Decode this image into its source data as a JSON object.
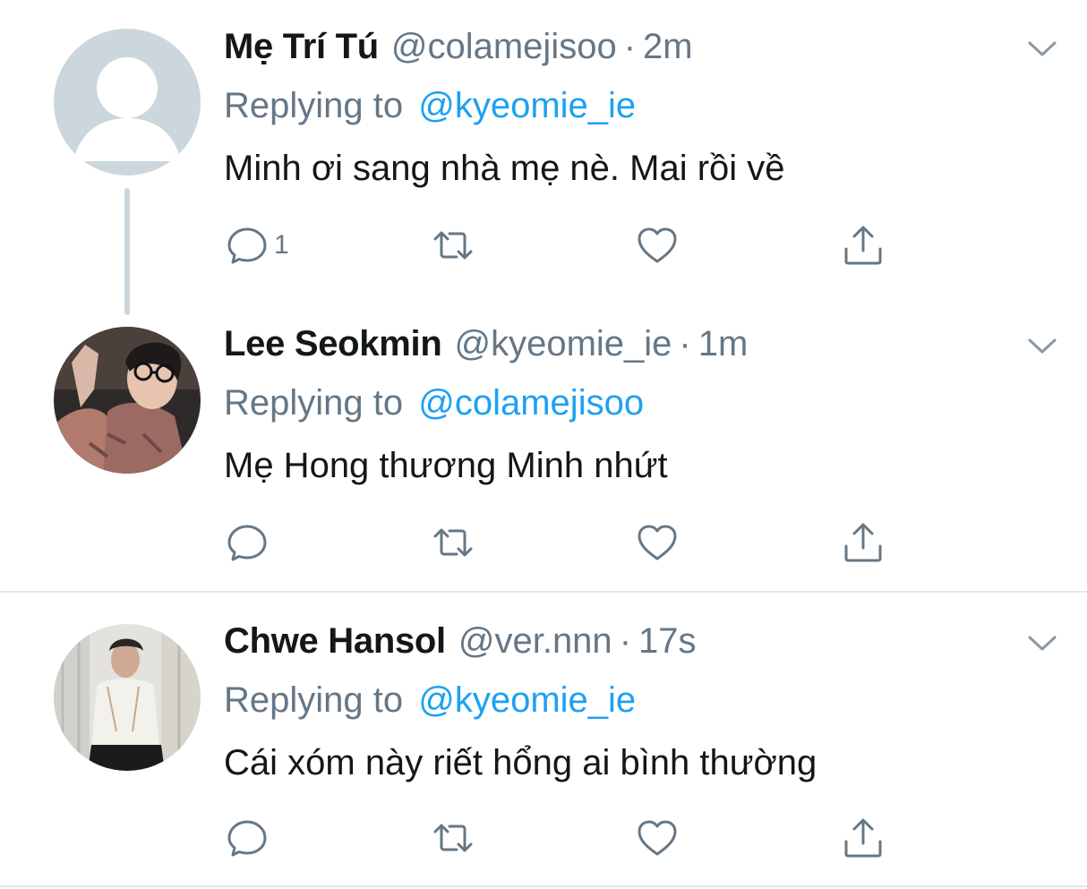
{
  "tweets": [
    {
      "display_name": "Mẹ Trí Tú",
      "handle": "@colamejisoo",
      "dot": "·",
      "time": "2m",
      "replying_label": "Replying to",
      "replying_to": "@kyeomie_ie",
      "text": "Minh ơi sang nhà mẹ nè. Mai rồi về",
      "reply_count": "1",
      "avatar": "default-avatar-icon"
    },
    {
      "display_name": "Lee Seokmin",
      "handle": "@kyeomie_ie",
      "dot": "·",
      "time": "1m",
      "replying_label": "Replying to",
      "replying_to": "@colamejisoo",
      "text": "Mẹ Hong thương Minh nhứt",
      "reply_count": "",
      "avatar": "user-photo"
    },
    {
      "display_name": "Chwe Hansol",
      "handle": "@ver.nnn",
      "dot": "·",
      "time": "17s",
      "replying_label": "Replying to",
      "replying_to": "@kyeomie_ie",
      "text": "Cái xóm này riết hổng ai bình thường",
      "reply_count": "",
      "avatar": "user-photo"
    }
  ],
  "icons": {
    "reply": "reply-icon",
    "retweet": "retweet-icon",
    "like": "heart-icon",
    "share": "share-icon",
    "more": "chevron-down-icon"
  },
  "colors": {
    "text": "#14171a",
    "secondary": "#657786",
    "link": "#1da1f2",
    "divider": "#e1e8ed",
    "thread_line": "#ccd6dd"
  }
}
